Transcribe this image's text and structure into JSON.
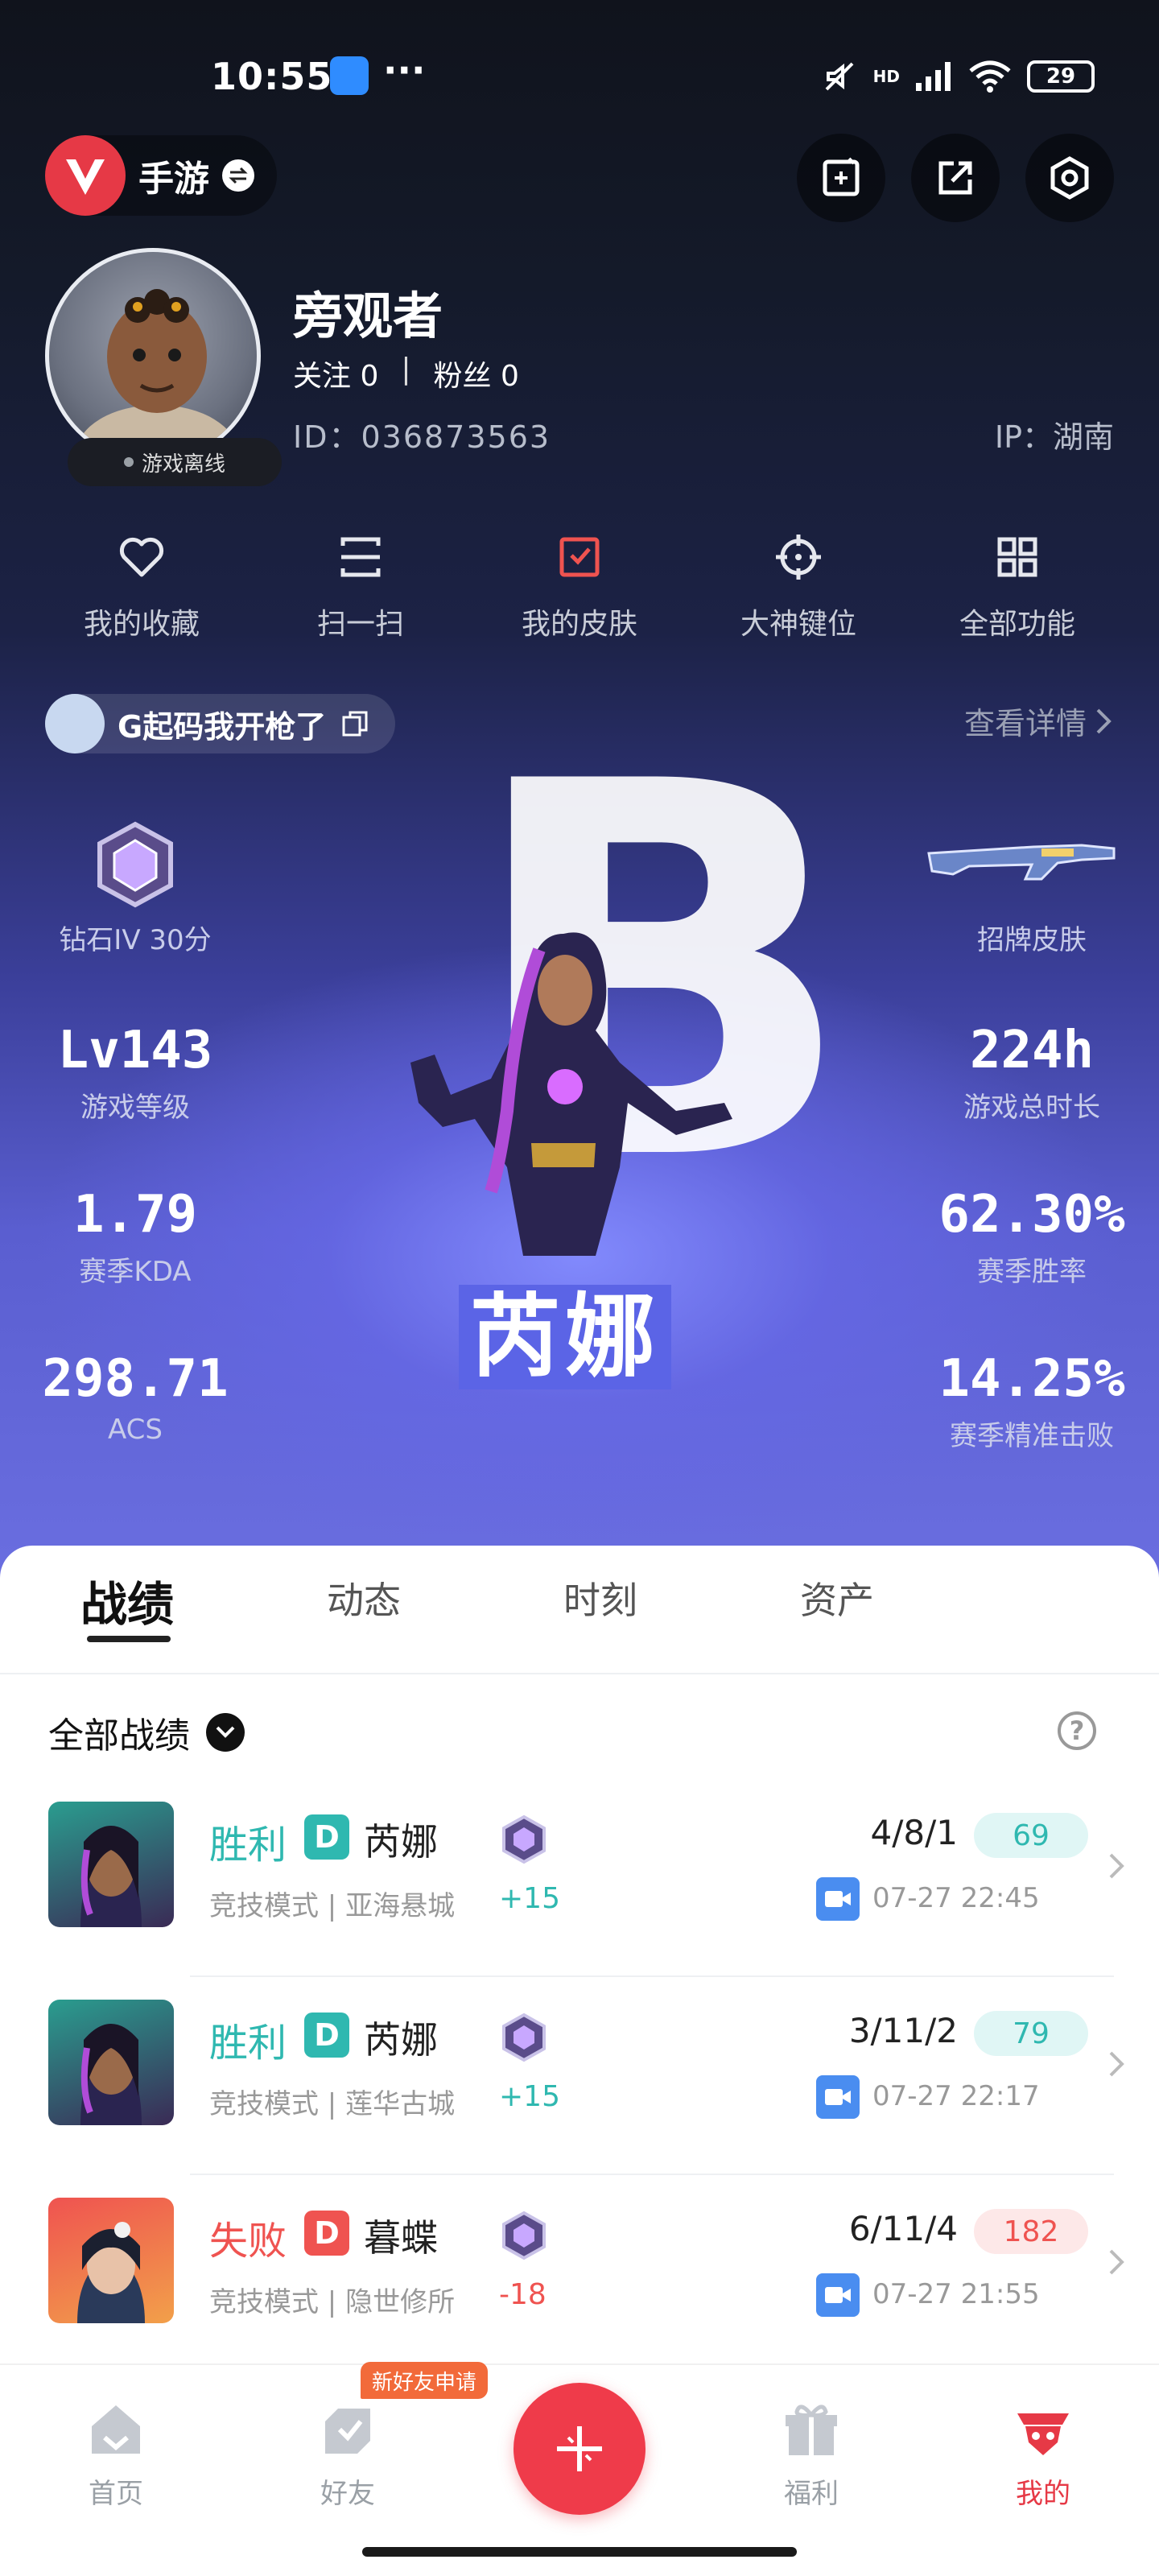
{
  "status_bar": {
    "time": "10:55",
    "battery": "29",
    "network": "HD"
  },
  "header": {
    "mode_label": "手游"
  },
  "profile": {
    "username": "旁观者",
    "follow_label": "关注",
    "follow_count": "0",
    "fans_label": "粉丝",
    "fans_count": "0",
    "id_text": "ID：036873563",
    "ip_text": "IP：湖南",
    "online_status": "游戏离线"
  },
  "quick_actions": [
    {
      "label": "我的收藏",
      "icon": "heart-icon"
    },
    {
      "label": "扫一扫",
      "icon": "scan-icon"
    },
    {
      "label": "我的皮肤",
      "icon": "skin-icon",
      "color": "#ef5350"
    },
    {
      "label": "大神键位",
      "icon": "crosshair-icon"
    },
    {
      "label": "全部功能",
      "icon": "grid-icon"
    }
  ],
  "title_badge": {
    "text": "G起码我开枪了"
  },
  "details_link": "查看详情",
  "hero_stats": {
    "rank_letter": "B",
    "agent_name": "芮娜",
    "rank": "钻石IV 30分",
    "skin": "招牌皮肤",
    "level_value": "Lv143",
    "level_label": "游戏等级",
    "playtime_value": "224h",
    "playtime_label": "游戏总时长",
    "kda_value": "1.79",
    "kda_label": "赛季KDA",
    "winrate_value": "62.30%",
    "winrate_label": "赛季胜率",
    "acs_value": "298.71",
    "acs_label": "ACS",
    "hs_value": "14.25%",
    "hs_label": "赛季精准击败"
  },
  "tabs": [
    "战绩",
    "动态",
    "时刻",
    "资产"
  ],
  "filter": {
    "label": "全部战绩",
    "help": "?"
  },
  "matches": [
    {
      "result": "胜利",
      "tag": "D",
      "agent": "芮娜",
      "mode": "竞技模式 | 亚海悬城",
      "delta": "+15",
      "kda": "4/8/1",
      "score": "69",
      "time": "07-27 22:45",
      "win": true,
      "avatar_color": "#2a9d8f"
    },
    {
      "result": "胜利",
      "tag": "D",
      "agent": "芮娜",
      "mode": "竞技模式 | 莲华古城",
      "delta": "+15",
      "kda": "3/11/2",
      "score": "79",
      "time": "07-27 22:17",
      "win": true,
      "avatar_color": "#2a9d8f"
    },
    {
      "result": "失败",
      "tag": "D",
      "agent": "暮蝶",
      "mode": "竞技模式 | 隐世修所",
      "delta": "-18",
      "kda": "6/11/4",
      "score": "182",
      "time": "07-27 21:55",
      "win": false,
      "avatar_color": "#ef5350"
    }
  ],
  "bottom_nav": {
    "items": [
      "首页",
      "好友",
      "福利",
      "我的"
    ],
    "badge": "新好友申请",
    "active": "我的"
  },
  "colors": {
    "accent": "#e63946",
    "win": "#2fb8b0",
    "lose": "#ef5350"
  }
}
